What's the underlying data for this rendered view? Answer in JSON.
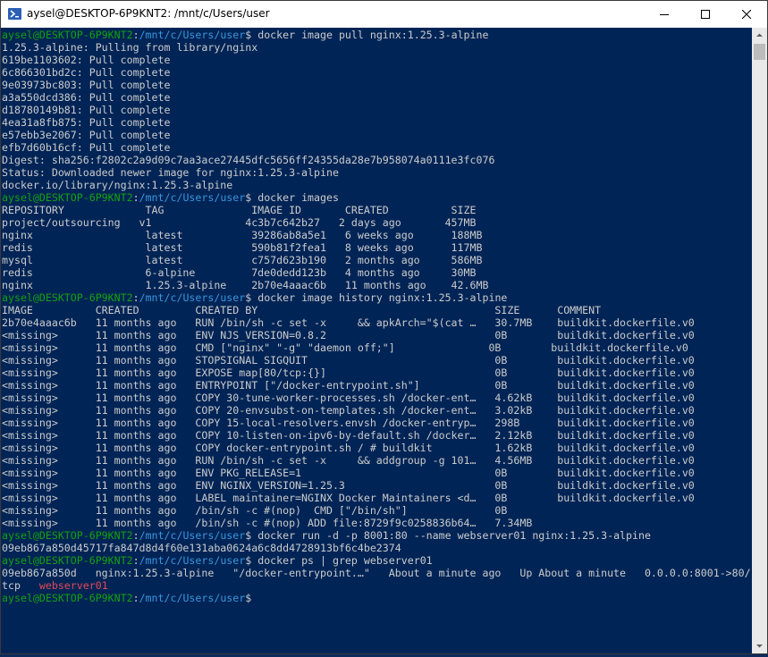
{
  "window": {
    "title": "aysel@DESKTOP-6P9KNT2: /mnt/c/Users/user",
    "app_icon": "powershell-terminal-icon"
  },
  "terminal": {
    "lines": [
      {
        "kind": "prompt",
        "user": "aysel@DESKTOP-6P9KNT2",
        "colon": ":",
        "path": "/mnt/c/Users/user",
        "cmd": "$ docker image pull nginx:1.25.3-alpine"
      },
      {
        "kind": "out",
        "text": "1.25.3-alpine: Pulling from library/nginx"
      },
      {
        "kind": "out",
        "text": "619be1103602: Pull complete"
      },
      {
        "kind": "out",
        "text": "6c866301bd2c: Pull complete"
      },
      {
        "kind": "out",
        "text": "9e03973bc803: Pull complete"
      },
      {
        "kind": "out",
        "text": "a3a550dcd386: Pull complete"
      },
      {
        "kind": "out",
        "text": "d18780149b81: Pull complete"
      },
      {
        "kind": "out",
        "text": "4ea31a8fb875: Pull complete"
      },
      {
        "kind": "out",
        "text": "e57ebb3e2067: Pull complete"
      },
      {
        "kind": "out",
        "text": "efb7d60b16cf: Pull complete"
      },
      {
        "kind": "out",
        "text": "Digest: sha256:f2802c2a9d09c7aa3ace27445dfc5656ff24355da28e7b958074a0111e3fc076"
      },
      {
        "kind": "out",
        "text": "Status: Downloaded newer image for nginx:1.25.3-alpine"
      },
      {
        "kind": "out",
        "text": "docker.io/library/nginx:1.25.3-alpine"
      },
      {
        "kind": "prompt",
        "user": "aysel@DESKTOP-6P9KNT2",
        "colon": ":",
        "path": "/mnt/c/Users/user",
        "cmd": "$ docker images"
      },
      {
        "kind": "out",
        "text": "REPOSITORY             TAG              IMAGE ID       CREATED          SIZE"
      },
      {
        "kind": "out",
        "text": "project/outsourcing   v1               4c3b7c642b27   2 days ago       457MB"
      },
      {
        "kind": "out",
        "text": "nginx                  latest           39286ab8a5e1   6 weeks ago      188MB"
      },
      {
        "kind": "out",
        "text": "redis                  latest           590b81f2fea1   8 weeks ago      117MB"
      },
      {
        "kind": "out",
        "text": "mysql                  latest           c757d623b190   2 months ago     586MB"
      },
      {
        "kind": "out",
        "text": "redis                  6-alpine         7de0dedd123b   4 months ago     30MB"
      },
      {
        "kind": "out",
        "text": "nginx                  1.25.3-alpine    2b70e4aaac6b   11 months ago    42.6MB"
      },
      {
        "kind": "prompt",
        "user": "aysel@DESKTOP-6P9KNT2",
        "colon": ":",
        "path": "/mnt/c/Users/user",
        "cmd": "$ docker image history nginx:1.25.3-alpine"
      },
      {
        "kind": "out",
        "text": "IMAGE          CREATED         CREATED BY                                      SIZE      COMMENT"
      },
      {
        "kind": "out",
        "text": "2b70e4aaac6b   11 months ago   RUN /bin/sh -c set -x     && apkArch=\"$(cat …   30.7MB    buildkit.dockerfile.v0"
      },
      {
        "kind": "out",
        "text": "<missing>      11 months ago   ENV NJS_VERSION=0.8.2                           0B        buildkit.dockerfile.v0"
      },
      {
        "kind": "out",
        "text": "<missing>      11 months ago   CMD [\"nginx\" \"-g\" \"daemon off;\"]               0B        buildkit.dockerfile.v0"
      },
      {
        "kind": "out",
        "text": "<missing>      11 months ago   STOPSIGNAL SIGQUIT                              0B        buildkit.dockerfile.v0"
      },
      {
        "kind": "out",
        "text": "<missing>      11 months ago   EXPOSE map[80/tcp:{}]                           0B        buildkit.dockerfile.v0"
      },
      {
        "kind": "out",
        "text": "<missing>      11 months ago   ENTRYPOINT [\"/docker-entrypoint.sh\"]            0B        buildkit.dockerfile.v0"
      },
      {
        "kind": "out",
        "text": "<missing>      11 months ago   COPY 30-tune-worker-processes.sh /docker-ent…   4.62kB    buildkit.dockerfile.v0"
      },
      {
        "kind": "out",
        "text": "<missing>      11 months ago   COPY 20-envsubst-on-templates.sh /docker-ent…   3.02kB    buildkit.dockerfile.v0"
      },
      {
        "kind": "out",
        "text": "<missing>      11 months ago   COPY 15-local-resolvers.envsh /docker-entryp…   298B      buildkit.dockerfile.v0"
      },
      {
        "kind": "out",
        "text": "<missing>      11 months ago   COPY 10-listen-on-ipv6-by-default.sh /docker…   2.12kB    buildkit.dockerfile.v0"
      },
      {
        "kind": "out",
        "text": "<missing>      11 months ago   COPY docker-entrypoint.sh / # buildkit          1.62kB    buildkit.dockerfile.v0"
      },
      {
        "kind": "out",
        "text": "<missing>      11 months ago   RUN /bin/sh -c set -x     && addgroup -g 101…   4.56MB    buildkit.dockerfile.v0"
      },
      {
        "kind": "out",
        "text": "<missing>      11 months ago   ENV PKG_RELEASE=1                               0B        buildkit.dockerfile.v0"
      },
      {
        "kind": "out",
        "text": "<missing>      11 months ago   ENV NGINX_VERSION=1.25.3                        0B        buildkit.dockerfile.v0"
      },
      {
        "kind": "out",
        "text": "<missing>      11 months ago   LABEL maintainer=NGINX Docker Maintainers <d…   0B        buildkit.dockerfile.v0"
      },
      {
        "kind": "out",
        "text": "<missing>      11 months ago   /bin/sh -c #(nop)  CMD [\"/bin/sh\"]              0B"
      },
      {
        "kind": "out",
        "text": "<missing>      11 months ago   /bin/sh -c #(nop) ADD file:8729f9c0258836b64…   7.34MB"
      },
      {
        "kind": "prompt",
        "user": "aysel@DESKTOP-6P9KNT2",
        "colon": ":",
        "path": "/mnt/c/Users/user",
        "cmd": "$ docker run -d -p 8001:80 --name webserver01 nginx:1.25.3-alpine"
      },
      {
        "kind": "out",
        "text": "09eb867a850d45717fa847d8d4f60e131aba0624a6c8dd4728913bf6c4be2374"
      },
      {
        "kind": "prompt",
        "user": "aysel@DESKTOP-6P9KNT2",
        "colon": ":",
        "path": "/mnt/c/Users/user",
        "cmd": "$ docker ps | grep webserver01"
      },
      {
        "kind": "out",
        "text": "09eb867a850d   nginx:1.25.3-alpine   \"/docker-entrypoint.…\"   About a minute ago   Up About a minute   0.0.0.0:8001->80/"
      },
      {
        "kind": "highlight",
        "text": "tcp   ",
        "hl": "webserver01"
      },
      {
        "kind": "prompt",
        "user": "aysel@DESKTOP-6P9KNT2",
        "colon": ":",
        "path": "/mnt/c/Users/user",
        "cmd": "$"
      }
    ]
  }
}
